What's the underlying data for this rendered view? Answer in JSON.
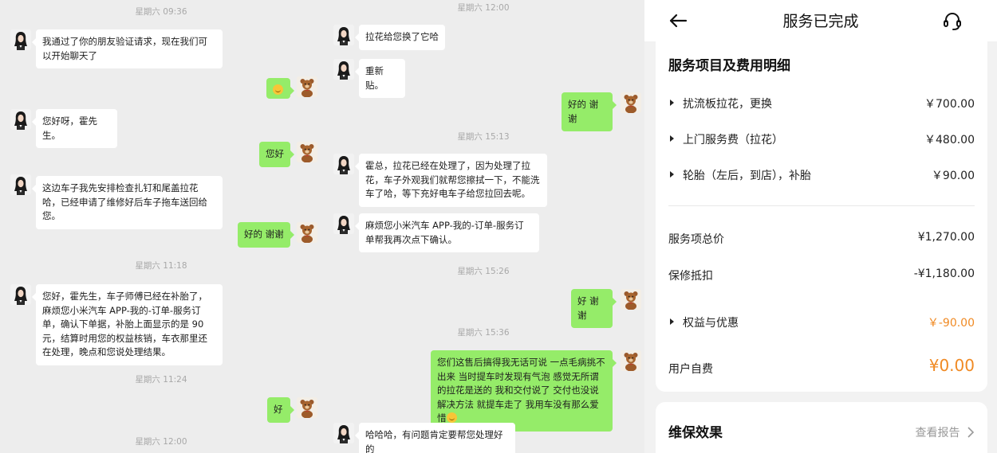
{
  "chat_left": {
    "timestamps": [
      "星期六 09:36",
      "星期六 11:18",
      "星期六 11:24",
      "星期六 12:00"
    ],
    "messages": [
      "我通过了你的朋友验证请求，现在我们可以开始聊天了",
      "",
      "您好呀，霍先生。",
      "您好",
      "这边车子我先安排检查扎钉和尾盖拉花哈，已经申请了维修好后车子拖车送回给您。",
      "好的 谢谢",
      "您好，霍先生，车子师傅已经在补胎了，麻烦您小米汽车 APP-我的-订单-服务订单，确认下单据，补胎上面显示的是 90元，结算时用您的权益核销，车衣那里还在处理，晚点和您说处理结果。",
      "好"
    ]
  },
  "chat_right": {
    "timestamps": [
      "星期六 12:00",
      "星期六 15:13",
      "星期六 15:26",
      "星期六 15:36"
    ],
    "messages": [
      "拉花给您换了它哈",
      "重新贴。",
      "好的 谢谢",
      "霍总，拉花已经在处理了，因为处理了拉花，车子外观我们就帮您擦拭一下，不能洗车了哈，等下充好电车子给您拉回去呢。",
      "麻烦您小米汽车 APP-我的-订单-服务订单帮我再次点下确认。",
      "好 谢谢",
      "您们这售后搞得我无话可说  一点毛病挑不出来 当时提车时发现有气泡 感觉无所谓的拉花是送的 我和交付说了 交付也没说解决方法 就提车走了 我用车没有那么爱惜",
      "哈哈哈，有问题肯定要帮您处理好的"
    ]
  },
  "panel": {
    "title": "服务已完成",
    "back_icon": "arrow-left-icon",
    "support_icon": "headset-icon",
    "section_title": "服务项目及费用明细",
    "items": [
      {
        "label": "扰流板拉花，更换",
        "value": "￥700.00"
      },
      {
        "label": "上门服务费（拉花）",
        "value": "￥480.00"
      },
      {
        "label": "轮胎（左后，到店），补胎",
        "value": "￥90.00"
      }
    ],
    "total_label": "服务项总价",
    "total_value": "¥1,270.00",
    "warranty_label": "保修抵扣",
    "warranty_value": "-¥1,180.00",
    "benefit_label": "权益与优惠",
    "benefit_value": "￥-90.00",
    "pay_label": "用户自费",
    "pay_value": "¥0.00",
    "effect_title": "维保效果",
    "report_label": "查看报告",
    "accent_color": "#f08a24",
    "bubble_green": "#95ec69"
  }
}
